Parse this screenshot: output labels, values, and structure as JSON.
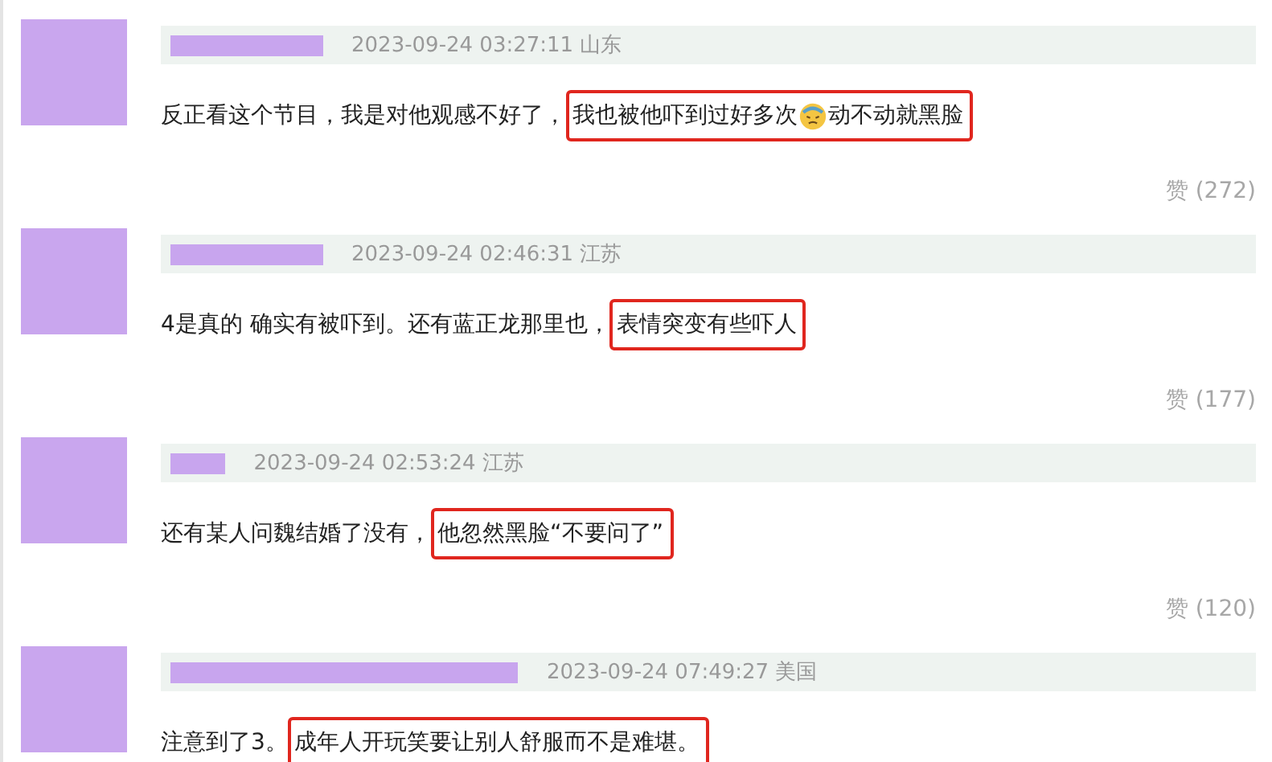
{
  "comments": [
    {
      "redacted_name": {
        "level": 0.14
      },
      "date": "2023-09-24 03:27:11 山东",
      "segments": [
        {
          "highlighted": false,
          "parts": [
            {
              "kind": "text",
              "text": "反正看这个节目，我是对他观感不好了，"
            }
          ]
        },
        {
          "highlighted": true,
          "parts": [
            {
              "kind": "text",
              "text": "我也被他吓到过好多次"
            },
            {
              "kind": "emoji"
            },
            {
              "kind": "text",
              "text": "动不动就黑脸"
            }
          ]
        }
      ],
      "likes": "赞 (272)"
    },
    {
      "redacted_name": {
        "level": 0.14
      },
      "date": "2023-09-24 02:46:31 江苏",
      "segments": [
        {
          "highlighted": false,
          "parts": [
            {
              "kind": "text",
              "text": "4是真的 确实有被吓到。还有蓝正龙那里也，"
            }
          ]
        },
        {
          "highlighted": true,
          "parts": [
            {
              "kind": "text",
              "text": "表情突变有些吓人"
            }
          ]
        }
      ],
      "likes": "赞 (177)"
    },
    {
      "redacted_name": {
        "level": 0.05
      },
      "date": "2023-09-24 02:53:24 江苏",
      "segments": [
        {
          "highlighted": false,
          "parts": [
            {
              "kind": "text",
              "text": "还有某人问魏结婚了没有，"
            }
          ]
        },
        {
          "highlighted": true,
          "parts": [
            {
              "kind": "text",
              "text": "他忽然黑脸“不要问了”"
            }
          ]
        }
      ],
      "likes": "赞 (120)"
    },
    {
      "redacted_name": {
        "level": 0.32
      },
      "date": "2023-09-24 07:49:27 美国",
      "segments": [
        {
          "highlighted": false,
          "parts": [
            {
              "kind": "text",
              "text": "注意到了3。"
            }
          ]
        },
        {
          "highlighted": true,
          "parts": [
            {
              "kind": "text",
              "text": "成年人开玩笑要让别人舒服而不是难堪。"
            }
          ]
        }
      ]
    }
  ]
}
